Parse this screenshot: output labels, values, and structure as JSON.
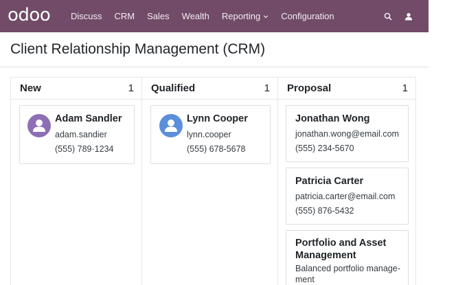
{
  "app": {
    "logo_text": "odoo",
    "menu": [
      {
        "label": "Discuss"
      },
      {
        "label": "CRM"
      },
      {
        "label": "Sales"
      },
      {
        "label": "Wealth"
      },
      {
        "label": "Reporting",
        "has_dropdown": true
      },
      {
        "label": "Configuration"
      }
    ],
    "actions": [
      "search-icon",
      "user-icon"
    ],
    "colors": {
      "navbar": "#714b67",
      "avatar_purple": "#8e6fb5",
      "avatar_blue": "#5b8fdb"
    }
  },
  "page": {
    "title": "Client Relationship Management (CRM)"
  },
  "kanban": {
    "columns": [
      {
        "title": "New",
        "count": "1",
        "cards": [
          {
            "name": "Adam Sandler",
            "email": "adam.sandier",
            "phone": "(555) 789·1234",
            "avatar": "user-icon"
          }
        ]
      },
      {
        "title": "Qualified",
        "count": "1",
        "cards": [
          {
            "name": "Lynn Cooper",
            "email": "lynn.cooper",
            "phone": "(555) 678-5678",
            "avatar": "user-icon"
          }
        ]
      },
      {
        "title": "Proposal",
        "count": "1",
        "cards": [
          {
            "name": "Jonathan Wong",
            "email": "jonathan.wong@email.com",
            "phone": "(555) 234-5670"
          },
          {
            "name": "Patricia Carter",
            "email": "patricia.carter@email.com",
            "phone": "(555) 876-5432"
          },
          {
            "name": "Portfolio and Asset Management",
            "description": "Balanced portfolio manage-ment"
          }
        ]
      }
    ]
  }
}
